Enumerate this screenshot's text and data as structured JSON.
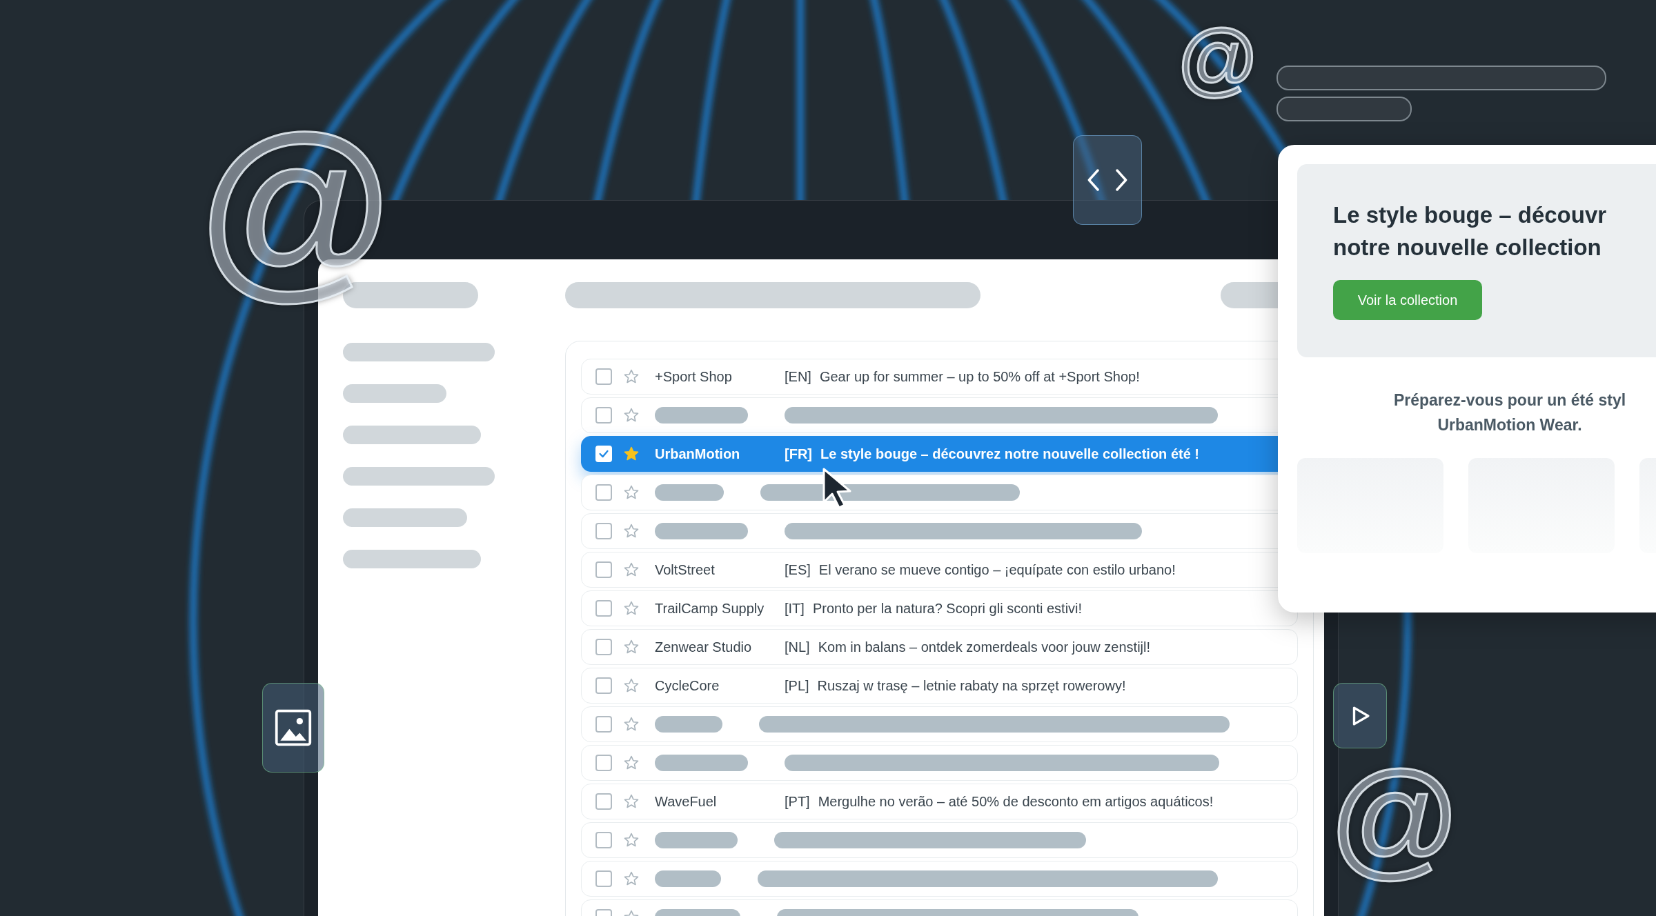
{
  "inbox": {
    "rows": [
      {
        "kind": "message",
        "sender": "+Sport Shop",
        "tag": "[EN]",
        "subject": "Gear up for summer – up to 50% off at +Sport Shop!",
        "checked": false,
        "starred": false,
        "selected": false
      },
      {
        "kind": "placeholder",
        "checked": false,
        "starred": false,
        "selected": false
      },
      {
        "kind": "message",
        "sender": "UrbanMotion",
        "tag": "[FR]",
        "subject": "Le style bouge – découvrez notre nouvelle collection été !",
        "checked": true,
        "starred": true,
        "selected": true
      },
      {
        "kind": "placeholder",
        "checked": false,
        "starred": false,
        "selected": false
      },
      {
        "kind": "placeholder",
        "checked": false,
        "starred": false,
        "selected": false
      },
      {
        "kind": "message",
        "sender": "VoltStreet",
        "tag": "[ES]",
        "subject": "El verano se mueve contigo – ¡equípate con estilo urbano!",
        "checked": false,
        "starred": false,
        "selected": false
      },
      {
        "kind": "message",
        "sender": "TrailCamp Supply",
        "tag": "[IT]",
        "subject": "Pronto per la natura? Scopri gli sconti estivi!",
        "checked": false,
        "starred": false,
        "selected": false
      },
      {
        "kind": "message",
        "sender": "Zenwear Studio",
        "tag": "[NL]",
        "subject": "Kom in balans – ontdek zomerdeals voor jouw zenstijl!",
        "checked": false,
        "starred": false,
        "selected": false
      },
      {
        "kind": "message",
        "sender": "CycleCore",
        "tag": "[PL]",
        "subject": "Ruszaj w trasę – letnie rabaty na sprzęt rowerowy!",
        "checked": false,
        "starred": false,
        "selected": false
      },
      {
        "kind": "placeholder",
        "checked": false,
        "starred": false,
        "selected": false
      },
      {
        "kind": "placeholder",
        "checked": false,
        "starred": false,
        "selected": false
      },
      {
        "kind": "message",
        "sender": "WaveFuel",
        "tag": "[PT]",
        "subject": "Mergulhe no verão – até 50% de desconto em artigos aquáticos!",
        "checked": false,
        "starred": false,
        "selected": false
      },
      {
        "kind": "placeholder",
        "checked": false,
        "starred": false,
        "selected": false
      },
      {
        "kind": "placeholder",
        "checked": false,
        "starred": false,
        "selected": false
      },
      {
        "kind": "placeholder",
        "checked": false,
        "starred": false,
        "selected": false
      }
    ]
  },
  "preview": {
    "title_lines": [
      "Le style bouge – découvr",
      "notre nouvelle collection"
    ],
    "button": "Voir la collection",
    "subtitle_lines": [
      "Préparez-vous pour un été styl",
      "UrbanMotion Wear."
    ]
  },
  "decorations": [
    {
      "symbol": "@"
    },
    {
      "symbol": "@"
    },
    {
      "symbol": "@"
    }
  ]
}
